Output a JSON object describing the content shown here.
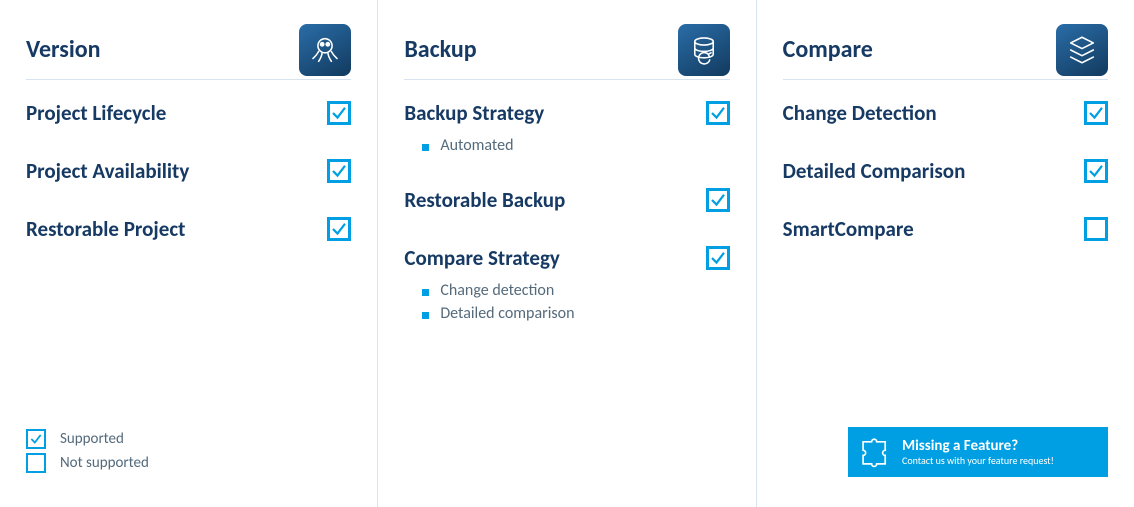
{
  "columns": [
    {
      "key": "version",
      "title": "Version",
      "iconName": "octopus-icon",
      "features": [
        {
          "name": "Project Lifecycle",
          "supported": true,
          "sub": []
        },
        {
          "name": "Project Availability",
          "supported": true,
          "sub": []
        },
        {
          "name": "Restorable Project",
          "supported": true,
          "sub": []
        }
      ]
    },
    {
      "key": "backup",
      "title": "Backup",
      "iconName": "database-refresh-icon",
      "features": [
        {
          "name": "Backup Strategy",
          "supported": true,
          "sub": [
            "Automated"
          ]
        },
        {
          "name": "Restorable Backup",
          "supported": true,
          "sub": []
        },
        {
          "name": "Compare Strategy",
          "supported": true,
          "sub": [
            "Change detection",
            "Detailed comparison"
          ]
        }
      ]
    },
    {
      "key": "compare",
      "title": "Compare",
      "iconName": "layers-icon",
      "features": [
        {
          "name": "Change Detection",
          "supported": true,
          "sub": []
        },
        {
          "name": "Detailed Comparison",
          "supported": true,
          "sub": []
        },
        {
          "name": "SmartCompare",
          "supported": false,
          "sub": []
        }
      ]
    }
  ],
  "legend": {
    "supported": "Supported",
    "notSupported": "Not supported"
  },
  "cta": {
    "title": "Missing a Feature?",
    "subtitle": "Contact us with your feature request!"
  },
  "colors": {
    "brandBlue": "#173a64",
    "accent": "#009fe3"
  }
}
